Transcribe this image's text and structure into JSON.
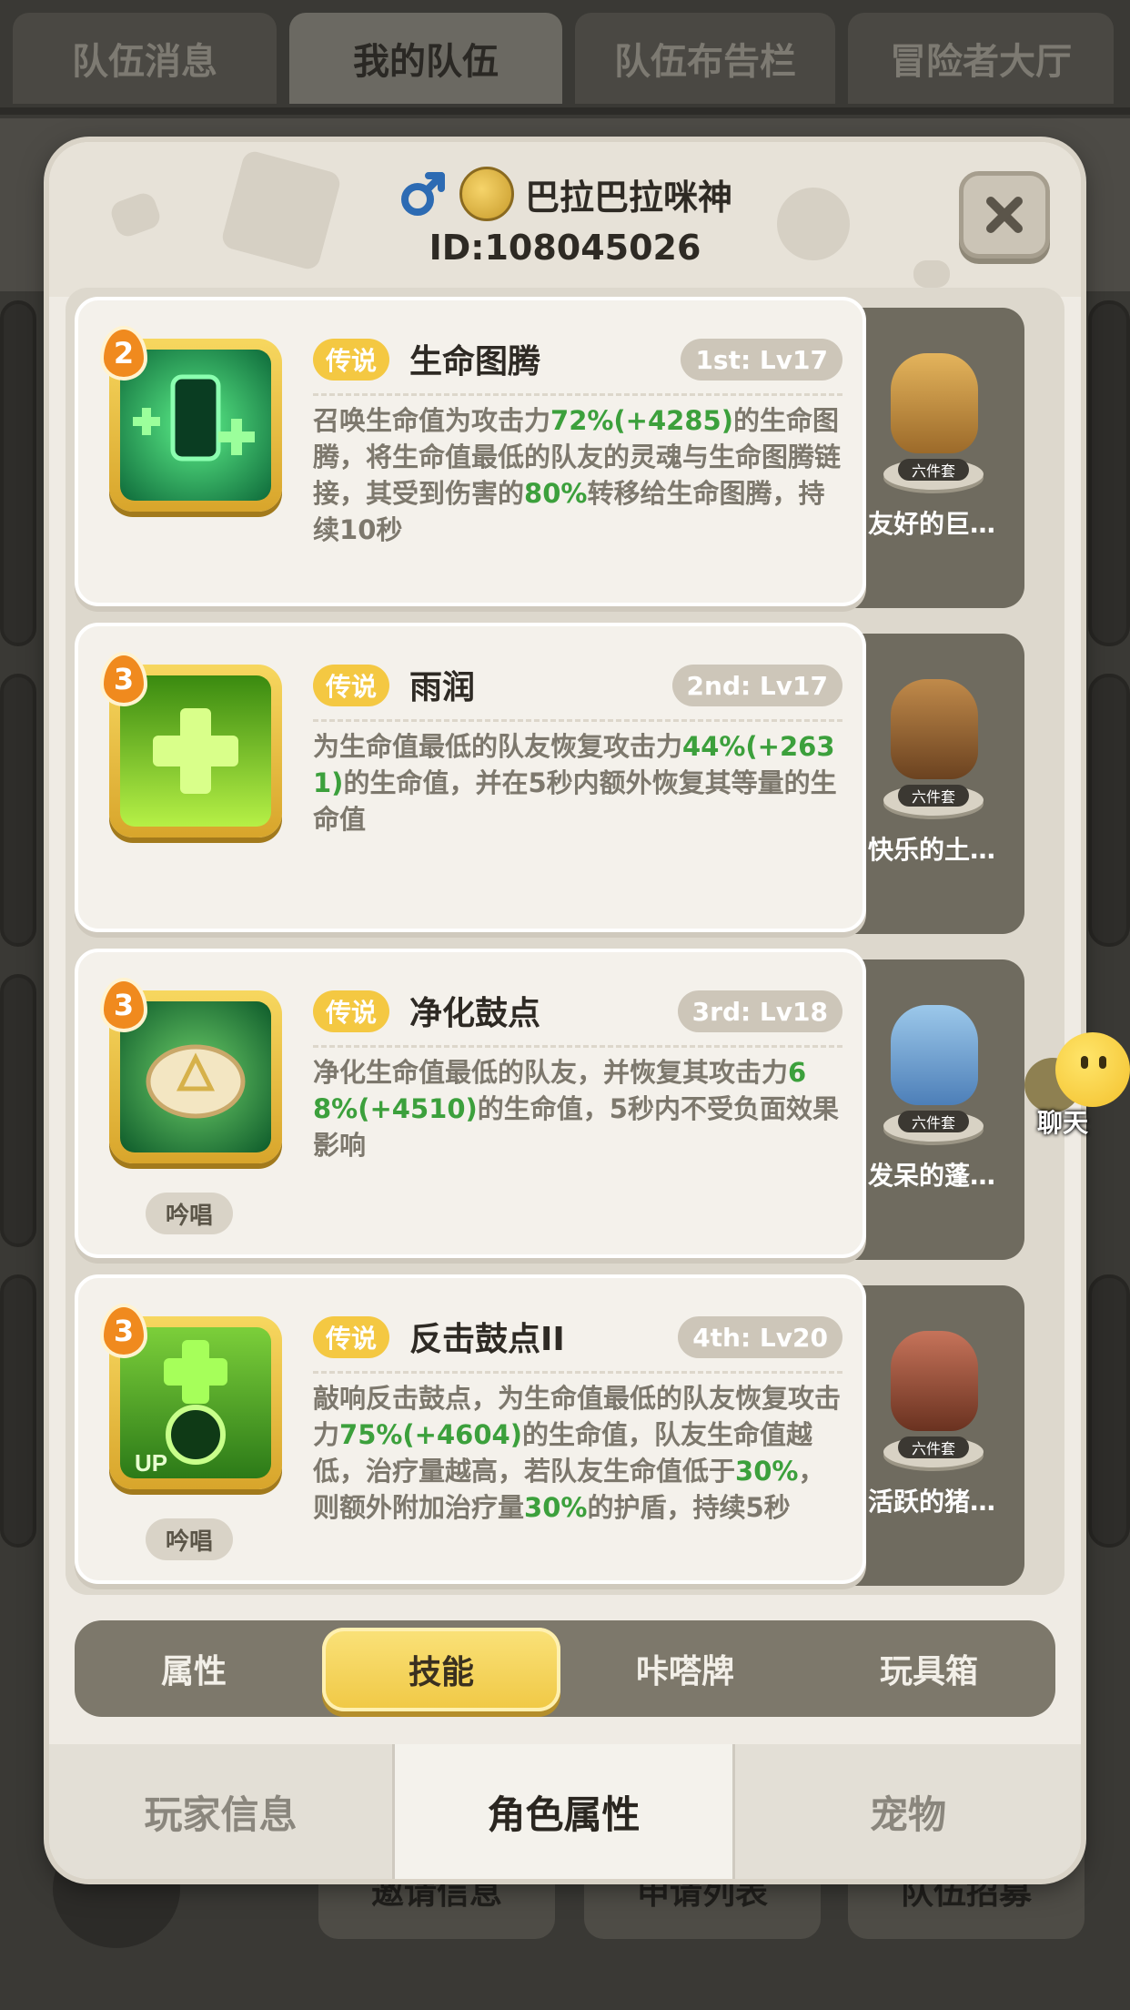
{
  "top_tabs": [
    "队伍消息",
    "我的队伍",
    "队伍布告栏",
    "冒险者大厅"
  ],
  "bottom_bg_buttons": [
    "邀请信息",
    "申请列表",
    "队伍招募"
  ],
  "player": {
    "name": "巴拉巴拉咪神",
    "id": "ID:108045026",
    "gender_icon": "male-icon"
  },
  "skills": [
    {
      "level": "2",
      "rarity": "传说",
      "name": "生命图腾",
      "slot": "1st: Lv17",
      "desc": "召唤生命值为攻击力72%(+4285)的生命图腾，将生命值最低的队友的灵魂与生命图腾链接，其受到伤害的80%转移给生命图腾，持续10秒",
      "chant": "",
      "pet_name": "友好的巨…",
      "pet_tag": "六件套"
    },
    {
      "level": "3",
      "rarity": "传说",
      "name": "雨润",
      "slot": "2nd: Lv17",
      "desc": "为生命值最低的队友恢复攻击力44%(+2631)的生命值，并在5秒内额外恢复其等量的生命值",
      "chant": "",
      "pet_name": "快乐的土…",
      "pet_tag": "六件套"
    },
    {
      "level": "3",
      "rarity": "传说",
      "name": "净化鼓点",
      "slot": "3rd: Lv18",
      "desc": "净化生命值最低的队友，并恢复其攻击力68%(+4510)的生命值，5秒内不受负面效果影响",
      "chant": "吟唱",
      "pet_name": "发呆的蓬…",
      "pet_tag": "六件套"
    },
    {
      "level": "3",
      "rarity": "传说",
      "name": "反击鼓点II",
      "slot": "4th: Lv20",
      "desc": "敲响反击鼓点，为生命值最低的队友恢复攻击力75%(+4604)的生命值，队友生命值越低，治疗量越高，若队友生命值低于30%，则额外附加治疗量30%的护盾，持续5秒",
      "chant": "吟唱",
      "pet_name": "活跃的猪…",
      "pet_tag": "六件套"
    }
  ],
  "sub_tabs": [
    "属性",
    "技能",
    "咔嗒牌",
    "玩具箱"
  ],
  "bottom_tabs": [
    "玩家信息",
    "角色属性",
    "宠物"
  ],
  "chat": {
    "label": "聊天"
  },
  "colors": {
    "accent_gold": "#f4c842",
    "green_value": "#3ca03c",
    "panel": "#efebe4"
  }
}
